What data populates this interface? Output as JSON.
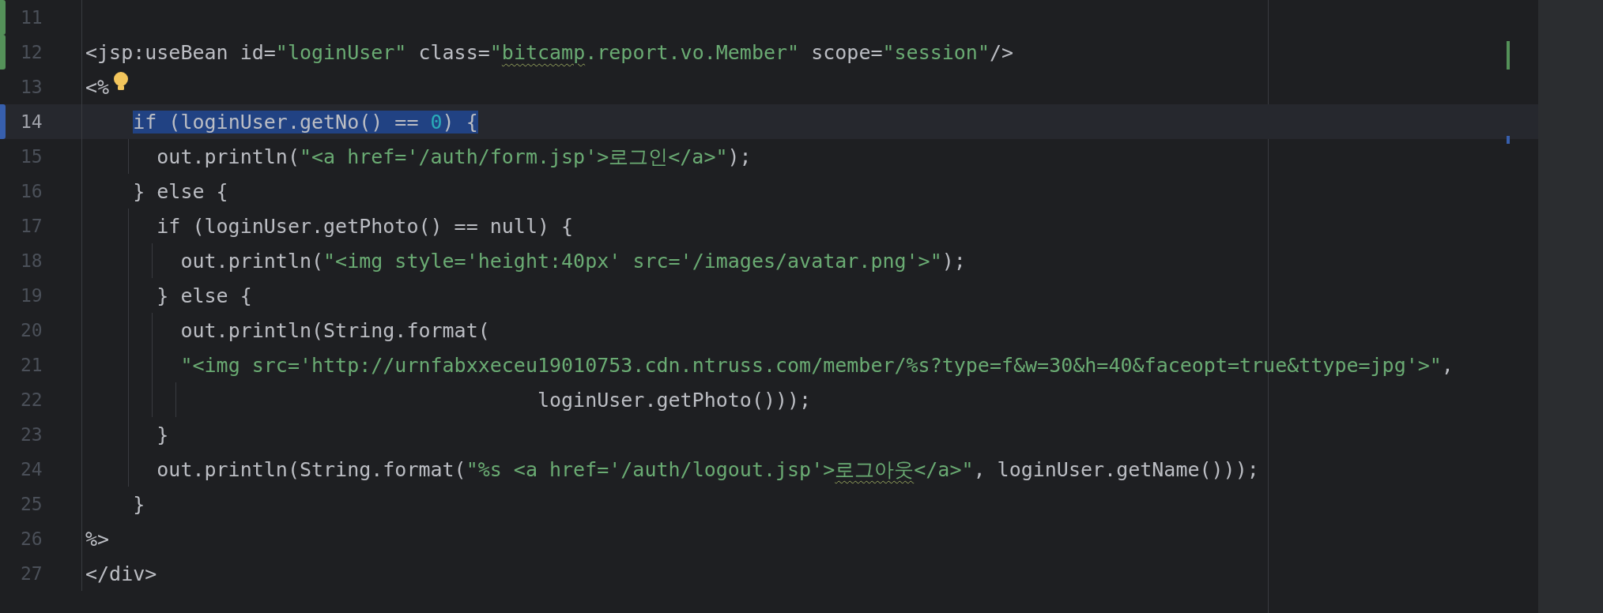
{
  "editor": {
    "lines": [
      {
        "number": "11",
        "current": false,
        "color": "#549159"
      },
      {
        "number": "12",
        "current": false,
        "selected": false,
        "color": "#549159",
        "segments": [
          {
            "kind": "plain",
            "text": "<jsp:useBean id="
          },
          {
            "kind": "string",
            "text": "\"loginUser\""
          },
          {
            "kind": "plain",
            "text": " class="
          },
          {
            "kind": "string",
            "text": "\""
          },
          {
            "kind": "string_warn",
            "text": "bitcamp"
          },
          {
            "kind": "string",
            "text": ".report.vo.Member\""
          },
          {
            "kind": "plain",
            "text": " scope="
          },
          {
            "kind": "string",
            "text": "\"session\""
          },
          {
            "kind": "plain",
            "text": "/>"
          }
        ]
      },
      {
        "number": "13",
        "current": false,
        "selected": false,
        "segments": [
          {
            "kind": "plain",
            "text": "<%"
          }
        ]
      },
      {
        "number": "14",
        "current": true,
        "selected": true,
        "color": "#375fad",
        "segments": [
          {
            "kind": "plain",
            "text": "    if (loginUser.getNo() == "
          },
          {
            "kind": "number",
            "text": "0"
          },
          {
            "kind": "plain",
            "text": ") {"
          }
        ]
      },
      {
        "number": "15",
        "current": false,
        "selected": false,
        "segments": [
          {
            "kind": "plain",
            "text": "      out.println("
          },
          {
            "kind": "string",
            "text": "\"<a href='/auth/form.jsp'>로그인</a>\""
          },
          {
            "kind": "plain",
            "text": ");"
          }
        ]
      },
      {
        "number": "16",
        "current": false,
        "selected": false,
        "segments": [
          {
            "kind": "plain",
            "text": "    } else {"
          }
        ]
      },
      {
        "number": "17",
        "current": false,
        "selected": false,
        "segments": [
          {
            "kind": "plain",
            "text": "      if (loginUser.getPhoto() == null) {"
          }
        ]
      },
      {
        "number": "18",
        "current": false,
        "selected": false,
        "segments": [
          {
            "kind": "plain",
            "text": "        out.println("
          },
          {
            "kind": "string",
            "text": "\"<img style='height:40px' src='/images/avatar.png'>\""
          },
          {
            "kind": "plain",
            "text": ");"
          }
        ]
      },
      {
        "number": "19",
        "current": false,
        "selected": false,
        "segments": [
          {
            "kind": "plain",
            "text": "      } else {"
          }
        ]
      },
      {
        "number": "20",
        "current": false,
        "selected": false,
        "segments": [
          {
            "kind": "plain",
            "text": "        out.println(String.format("
          }
        ]
      },
      {
        "number": "21",
        "current": false,
        "selected": false,
        "segments": [
          {
            "kind": "string",
            "text": "        \"<img src='http://urnfabxxeceu19010753.cdn.ntruss.com/member/%s?type=f&w=30&h=40&faceopt=true&ttype=jpg'>\""
          },
          {
            "kind": "plain",
            "text": ","
          }
        ]
      },
      {
        "number": "22",
        "current": false,
        "selected": false,
        "segments": [
          {
            "kind": "plain",
            "text": "                                      loginUser.getPhoto()));"
          }
        ]
      },
      {
        "number": "23",
        "current": false,
        "selected": false,
        "segments": [
          {
            "kind": "plain",
            "text": "      }"
          }
        ]
      },
      {
        "number": "24",
        "current": false,
        "selected": false,
        "segments": [
          {
            "kind": "plain",
            "text": "      out.println(String.format("
          },
          {
            "kind": "string",
            "text": "\"%s <a href='/auth/logout.jsp'>"
          },
          {
            "kind": "string_warn",
            "text": "로그아웃"
          },
          {
            "kind": "string",
            "text": "</a>\""
          },
          {
            "kind": "plain",
            "text": ", loginUser.getName()));"
          }
        ]
      },
      {
        "number": "25",
        "current": false,
        "selected": false,
        "segments": [
          {
            "kind": "plain",
            "text": "    }"
          }
        ]
      },
      {
        "number": "26",
        "current": false,
        "selected": false,
        "segments": [
          {
            "kind": "plain",
            "text": "%>"
          }
        ]
      },
      {
        "number": "27",
        "current": false,
        "selected": false,
        "segments": [
          {
            "kind": "plain",
            "text": "</div>"
          }
        ]
      }
    ]
  }
}
